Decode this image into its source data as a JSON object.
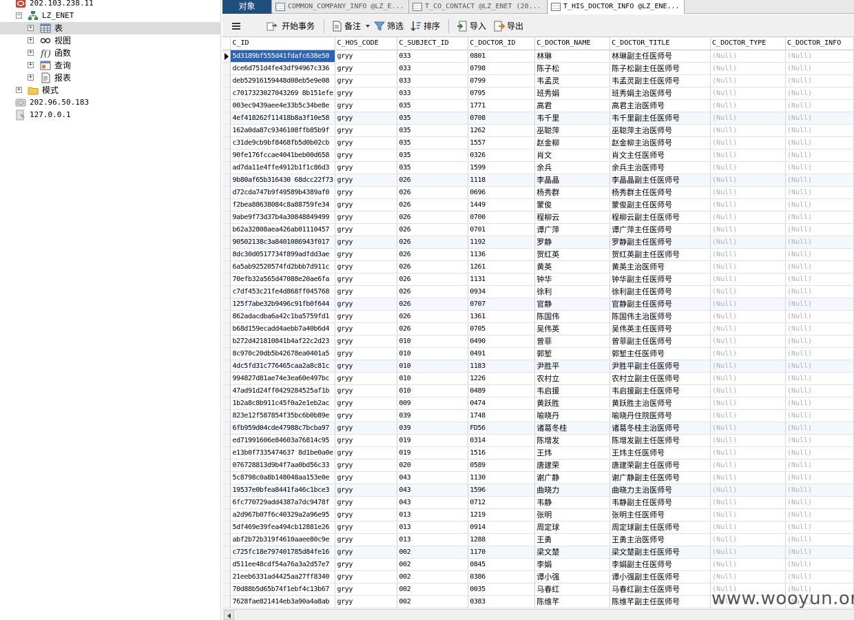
{
  "tree": {
    "nodes": [
      {
        "label": "202.103.238.11",
        "icon": "oracle-connection-icon"
      },
      {
        "label": "LZ_ENET",
        "icon": "schema-icon"
      },
      {
        "label": "表",
        "icon": "table-icon"
      },
      {
        "label": "视图",
        "icon": "view-icon"
      },
      {
        "label": "函数",
        "icon": "function-icon"
      },
      {
        "label": "查询",
        "icon": "query-icon"
      },
      {
        "label": "报表",
        "icon": "report-icon"
      },
      {
        "label": "模式",
        "icon": "folder-icon"
      },
      {
        "label": "202.96.50.183",
        "icon": "server-icon"
      },
      {
        "label": "127.0.0.1",
        "icon": "server-icon"
      }
    ]
  },
  "tabs": [
    {
      "label": "对象"
    },
    {
      "label": "COMMON_COMPANY_INFO @LZ_E..."
    },
    {
      "label": "T_CO_CONTACT @LZ_ENET (20..."
    },
    {
      "label": "T_HIS_DOCTOR_INFO @LZ_ENE..."
    }
  ],
  "toolbar": {
    "begin_transaction": "开始事务",
    "note": "备注",
    "filter": "筛选",
    "sort": "排序",
    "import": "导入",
    "export": "导出"
  },
  "grid": {
    "columns": [
      "C_ID",
      "C_HOS_CODE",
      "C_SUBJECT_ID",
      "C_DOCTOR_ID",
      "C_DOCTOR_NAME",
      "C_DOCTOR_TITLE",
      "C_DOCTOR_TYPE",
      "C_DOCTOR_INFO"
    ],
    "null_text": "(Null)",
    "rows": [
      [
        "5d3189bf555d41fdafc638e50",
        "gryy",
        "033",
        "0801",
        "林琳",
        "林琳副主任医师号"
      ],
      [
        "dce6d751d4fe43df94967c336",
        "gryy",
        "033",
        "0798",
        "陈子松",
        "陈子松副主任医师号"
      ],
      [
        "deb52916159448d08eb5e9e08",
        "gryy",
        "033",
        "0799",
        "韦孟灵",
        "韦孟灵副主任医师号"
      ],
      [
        "c7017323027043269 8b151efe",
        "gryy",
        "033",
        "0795",
        "班秀娟",
        "班秀娟主治医师号"
      ],
      [
        "003ec9439aee4e33b5c34be8e",
        "gryy",
        "035",
        "1771",
        "高君",
        "高君主治医师号"
      ],
      [
        "4ef418262f11418b8a3f10e58",
        "gryy",
        "035",
        "0708",
        "韦千里",
        "韦千里副主任医师号"
      ],
      [
        "162a0da87c9346108ffb85b9f",
        "gryy",
        "035",
        "1262",
        "巫聪萍",
        "巫聪萍主治医师号"
      ],
      [
        "c31de9cb9bf8468fb5d0b02cb",
        "gryy",
        "035",
        "1557",
        "赵金柳",
        "赵金柳主治医师号"
      ],
      [
        "90fe176fccae4041beb00d658",
        "gryy",
        "035",
        "0326",
        "肖文",
        "肖文主任医师号"
      ],
      [
        "ad7da11e4ffe4912b1f1c86d3",
        "gryy",
        "035",
        "1599",
        "余兵",
        "余兵主治医师号"
      ],
      [
        "9b80af65b316430 68dcc22f73",
        "gryy",
        "026",
        "1118",
        "李晶晶",
        "李晶晶副主任医师号"
      ],
      [
        "d72cda747b9f49589b4389af0",
        "gryy",
        "026",
        "0696",
        "杨秀群",
        "杨秀群主任医师号"
      ],
      [
        "f2bea88638084c8a88759fe34",
        "gryy",
        "026",
        "1449",
        "蒙俊",
        "蒙俊副主任医师号"
      ],
      [
        "9abe9f73d37b4a30848849499",
        "gryy",
        "026",
        "0700",
        "程柳云",
        "程柳云副主任医师号"
      ],
      [
        "b62a32808aea426ab01110457",
        "gryy",
        "026",
        "0701",
        "谭广萍",
        "谭广萍主任医师号"
      ],
      [
        "90502138c3a8401086943f017",
        "gryy",
        "026",
        "1192",
        "罗静",
        "罗静副主任医师号"
      ],
      [
        "8dc30d0517734f899adfdd3ae",
        "gryy",
        "026",
        "1136",
        "贺红英",
        "贺红英副主任医师号"
      ],
      [
        "6a5ab92520574fd2bbb7d911c",
        "gryy",
        "026",
        "1261",
        "黄英",
        "黄英主治医师号"
      ],
      [
        "70efb32a565d47088e20ae6fa",
        "gryy",
        "026",
        "1131",
        "钟华",
        "钟华副主任医师号"
      ],
      [
        "c7df453c21fe4d868ff045768",
        "gryy",
        "026",
        "0934",
        "徐利",
        "徐利副主任医师号"
      ],
      [
        "125f7abe32b9496c91fb0f644",
        "gryy",
        "026",
        "0707",
        "官静",
        "官静副主任医师号"
      ],
      [
        "862adacdba6a42c1ba5759fd1",
        "gryy",
        "026",
        "1361",
        "陈国伟",
        "陈国伟主治医师号"
      ],
      [
        "b68d159ecadd4aebb7a40b6d4",
        "gryy",
        "026",
        "0705",
        "吴伟英",
        "吴伟英主任医师号"
      ],
      [
        "b272d421810841b4af22c2d23",
        "gryy",
        "010",
        "0490",
        "曾菲",
        "曾菲副主任医师号"
      ],
      [
        "8c970c20db5b42678ea0401a5",
        "gryy",
        "010",
        "0491",
        "郭堑",
        "郭堑主任医师号"
      ],
      [
        "4dc5fd31c776465caa2a8c81c",
        "gryy",
        "010",
        "1183",
        "尹胜平",
        "尹胜平副主任医师号"
      ],
      [
        "994827d81ae74e3ea60e497bc",
        "gryy",
        "010",
        "1226",
        "农村立",
        "农村立副主任医师号"
      ],
      [
        "47ad91d24ff0429284525af1b",
        "gryy",
        "010",
        "0489",
        "韦启援",
        "韦启援副主任医师号"
      ],
      [
        "1b2a8c8b911c45f0a2e1eb2ac",
        "gryy",
        "009",
        "0474",
        "黄跃胜",
        "黄跃胜主治医师号"
      ],
      [
        "823e12f587854f35bc6b0b89e",
        "gryy",
        "039",
        "1748",
        "喻晓丹",
        "喻晓丹住院医师号"
      ],
      [
        "6fb959d04cde47988c7bcba97",
        "gryy",
        "039",
        "FD56",
        "诸葛冬桂",
        "诸葛冬桂主治医师号"
      ],
      [
        "ed71991606e84603a76814c95",
        "gryy",
        "019",
        "0314",
        "陈增发",
        "陈增发副主任医师号"
      ],
      [
        "e13b0f7335474637 8d1be0a0e",
        "gryy",
        "019",
        "1516",
        "王炜",
        "王炜主任医师号"
      ],
      [
        "076728813d9b4f7aa0bd56c33",
        "gryy",
        "020",
        "0589",
        "唐建荣",
        "唐建荣副主任医师号"
      ],
      [
        "5c8798c0a8b148048aa153e0e",
        "gryy",
        "043",
        "1130",
        "谢广静",
        "谢广静副主任医师号"
      ],
      [
        "19537e0bfea8441fa46c1bce3",
        "gryy",
        "043",
        "1596",
        "曲晓力",
        "曲晓力主治医师号"
      ],
      [
        "6fc770729add4387a7dc9478f",
        "gryy",
        "043",
        "0712",
        "韦静",
        "韦静副主任医师号"
      ],
      [
        "a2d967b07f6c40329a2a96e95",
        "gryy",
        "013",
        "1219",
        "张明",
        "张明主任医师号"
      ],
      [
        "5df469e39fea494cb12881e26",
        "gryy",
        "013",
        "0914",
        "周定球",
        "周定球副主任医师号"
      ],
      [
        "abf2b72b319f4610aaee80c9e",
        "gryy",
        "013",
        "1288",
        "王勇",
        "王勇主治医师号"
      ],
      [
        "c725fc18e797401785d84fe16",
        "gryy",
        "002",
        "1170",
        "梁文楚",
        "梁文楚副主任医师号"
      ],
      [
        "d511ee48cdf54a76a3a2d57e7",
        "gryy",
        "002",
        "0845",
        "李娟",
        "李娟副主任医师号"
      ],
      [
        "21eeb6331ad4425aa27ff8340",
        "gryy",
        "002",
        "0386",
        "谭小强",
        "谭小强副主任医师号"
      ],
      [
        "70d88b5d65b74f1ebf4c13b67",
        "gryy",
        "002",
        "0035",
        "马春红",
        "马春红副主任医师号"
      ],
      [
        "7628fae821414eb3a90a4a8ab",
        "gryy",
        "002",
        "0383",
        "陈维芊",
        "陈维芊副主任医师号"
      ]
    ]
  },
  "watermark": "www.wooyun.org"
}
